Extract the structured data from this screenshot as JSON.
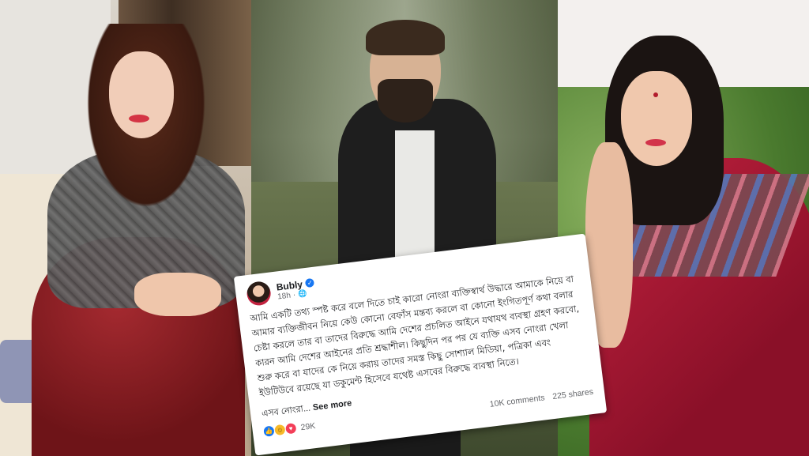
{
  "post": {
    "poster_name": "Bubly",
    "time_ago": "18h",
    "body": "আমি একটি তথ্য স্পষ্ট করে বলে দিতে চাই কারো নোংরা ব্যক্তিস্বার্থ উদ্ধারে আমাকে নিয়ে বা আমার ব্যক্তিজীবন নিয়ে কেউ কোনো বেফাঁস মন্তব্য করলে বা কোনো ইংগিতপূর্ণ কথা বলার চেষ্টা করলে তার বা তাদের বিরুদ্ধে আমি দেশের প্রচলিত আইনে যথাযথ ব্যবস্থা গ্রহণ করবো, কারন আমি দেশের আইনের প্রতি শ্রদ্ধাশীল। কিছুদিন পর পর যে ব্যক্তি এসব নোংরা খেলা শুরু করে বা যাদের কে নিয়ে করায় তাদের সমস্ত কিছু সোশ্যাল মিডিয়া, পত্রিকা এবং ইউটিউবে রয়েছে যা ডকুমেন্ট হিসেবে যথেষ্ট এসবের বিরুদ্ধে ব্যবস্থা নিতে।",
    "truncated_line": "এসব নোংরা...",
    "see_more_label": "See more",
    "reaction_count": "29K",
    "comments": "10K comments",
    "shares": "225 shares"
  },
  "icons": {
    "verified": "verified-badge-icon",
    "globe": "globe-icon",
    "reactions": [
      "like-icon",
      "haha-icon",
      "love-icon"
    ]
  },
  "colors": {
    "facebook_blue": "#1877f2",
    "card_bg": "#ffffff"
  }
}
